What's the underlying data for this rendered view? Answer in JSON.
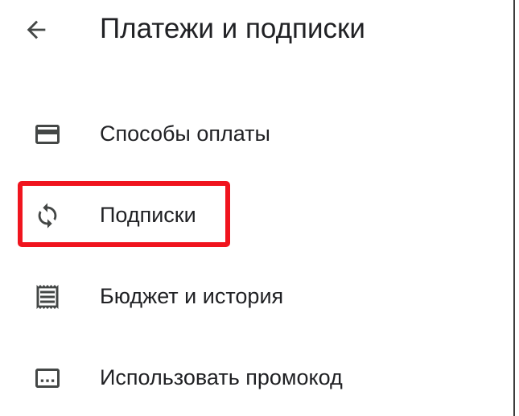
{
  "header": {
    "back_icon": "arrow-left-icon",
    "title": "Платежи и подписки"
  },
  "menu": {
    "items": [
      {
        "icon": "credit-card-icon",
        "label": "Способы оплаты"
      },
      {
        "icon": "sync-icon",
        "label": "Подписки"
      },
      {
        "icon": "receipt-icon",
        "label": "Бюджет и история"
      },
      {
        "icon": "promo-code-icon",
        "label": "Использовать промокод"
      }
    ]
  },
  "annotation": {
    "highlighted_item": "Подписки",
    "color": "#f0141e"
  },
  "colors": {
    "text": "#202124",
    "icon": "#444746",
    "background": "#ffffff"
  }
}
